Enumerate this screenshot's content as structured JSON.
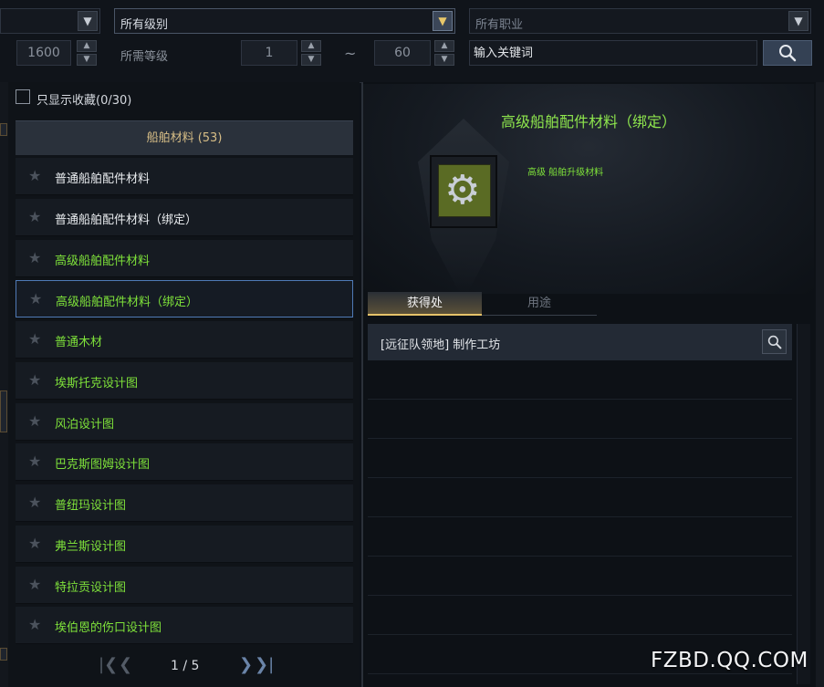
{
  "filters": {
    "dropdown_left_value": "",
    "level_dropdown": "所有级别",
    "job_dropdown": "所有职业",
    "item_level_value": "1600",
    "required_level_label": "所需等级",
    "level_min": "1",
    "tilde": "~",
    "level_max": "60",
    "search_placeholder": "输入关键词"
  },
  "list": {
    "favorites_only_label": "只显示收藏(0/30)",
    "category_header": "船舶材料 (53)",
    "items": [
      {
        "name": "普通船舶配件材料",
        "color": "#e9ecef"
      },
      {
        "name": "普通船舶配件材料（绑定）",
        "color": "#e9ecef"
      },
      {
        "name": "高级船舶配件材料",
        "color": "#7ee13a"
      },
      {
        "name": "高级船舶配件材料（绑定）",
        "color": "#7ee13a"
      },
      {
        "name": "普通木材",
        "color": "#7ee13a"
      },
      {
        "name": "埃斯托克设计图",
        "color": "#7ee13a"
      },
      {
        "name": "风泊设计图",
        "color": "#7ee13a"
      },
      {
        "name": "巴克斯图姆设计图",
        "color": "#7ee13a"
      },
      {
        "name": "普纽玛设计图",
        "color": "#7ee13a"
      },
      {
        "name": "弗兰斯设计图",
        "color": "#7ee13a"
      },
      {
        "name": "特拉贡设计图",
        "color": "#7ee13a"
      },
      {
        "name": "埃伯恩的伤口设计图",
        "color": "#7ee13a"
      }
    ],
    "star_glyph": "★",
    "selected_index": 3,
    "pagination": "1 / 5"
  },
  "detail": {
    "title": "高级船舶配件材料（绑定）",
    "subtitle": "高级 船舶升级材料",
    "icon": "gear-icon",
    "tabs": [
      "获得处",
      "用途"
    ],
    "active_tab": 0,
    "sources": [
      "[远征队领地] 制作工坊"
    ]
  },
  "watermark": "FZBD.QQ.COM",
  "colors": {
    "green_text": "#7ee13a",
    "gold_text": "#d6bd86",
    "selection_border": "#4f7ab6"
  }
}
